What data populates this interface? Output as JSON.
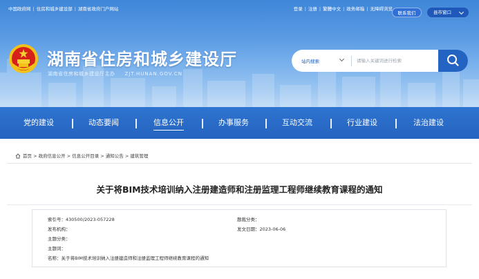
{
  "topbar": {
    "links": [
      "中国政府网",
      "住房和城乡建设部",
      "湖南省政府门户网站"
    ],
    "right_links": [
      "登录",
      "注册",
      "繁體中文",
      "政务邮箱",
      "无障碍浏览"
    ],
    "contact_label": "联系我们",
    "subsite_label": "县市窗口"
  },
  "site": {
    "title": "湖南省住房和城乡建设厅",
    "sponsor": "湖南省住房和城乡建设厅主办",
    "url": "ZJT.HUNAN.GOV.CN"
  },
  "search": {
    "scope": "站内搜索",
    "placeholder": "请输入关键词进行检索"
  },
  "nav": {
    "items": [
      "党的建设",
      "动态要闻",
      "信息公开",
      "办事服务",
      "互动交流",
      "行业建设",
      "法治建设"
    ]
  },
  "breadcrumb": {
    "items": [
      "首页",
      "政府信息公开",
      "信息公开目录",
      "通知公告",
      "建筑管理"
    ]
  },
  "article": {
    "title": "关于将BIM技术培训纳入注册建造师和注册监理工程师继续教育课程的通知"
  },
  "meta": {
    "index_label": "索引号：",
    "index_value": "430500/2023-057228",
    "category_label": "题裁分类：",
    "category_value": "",
    "org_label": "发布机构：",
    "org_value": "",
    "date_label": "发文日期：",
    "date_value": "2023-06-06",
    "topic_label": "主题分类：",
    "topic_value": "",
    "keyword_label": "主题词：",
    "keyword_value": "",
    "name_label": "名称：",
    "name_value": "关于将BIM技术培训纳入注册建造师和注册监理工程师继续教育课程的通知"
  },
  "colors": {
    "nav_bg": "#2563c0",
    "accent": "#2363c2",
    "header_sky": "#5a9be4"
  },
  "icons": [
    "national-emblem-icon",
    "search-icon",
    "home-icon",
    "chevron-down-icon"
  ]
}
